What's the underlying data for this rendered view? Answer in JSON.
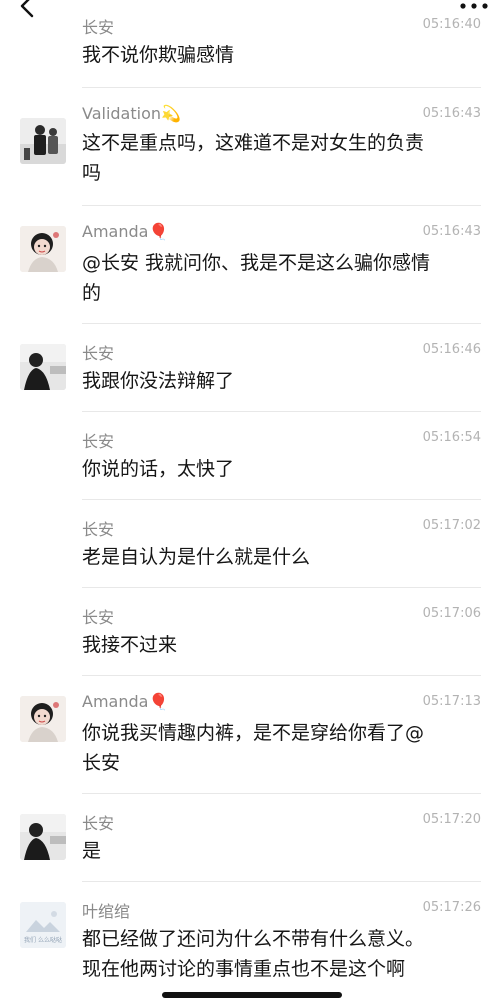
{
  "nav": {
    "back_icon": "chevron-left-icon",
    "more_icon": "ellipsis-icon"
  },
  "messages": [
    {
      "name": "长安",
      "time": "05:16:40",
      "text": "我不说你欺骗感情",
      "avatar": "none"
    },
    {
      "name": "Validation💫",
      "time": "05:16:43",
      "text": "这不是重点吗，这难道不是对女生的负责\n吗",
      "avatar": "validation"
    },
    {
      "name": "Amanda🎈",
      "time": "05:16:43",
      "text": "@长安 我就问你、我是不是这么骗你感情\n的",
      "avatar": "amanda"
    },
    {
      "name": "长安",
      "time": "05:16:46",
      "text": "我跟你没法辩解了",
      "avatar": "changan"
    },
    {
      "name": "长安",
      "time": "05:16:54",
      "text": "你说的话，太快了",
      "avatar": "none"
    },
    {
      "name": "长安",
      "time": "05:17:02",
      "text": "老是自认为是什么就是什么",
      "avatar": "none"
    },
    {
      "name": "长安",
      "time": "05:17:06",
      "text": "我接不过来",
      "avatar": "none"
    },
    {
      "name": "Amanda🎈",
      "time": "05:17:13",
      "text": "你说我买情趣内裤，是不是穿给你看了@\n长安",
      "avatar": "amanda"
    },
    {
      "name": "长安",
      "time": "05:17:20",
      "text": "是",
      "avatar": "changan"
    },
    {
      "name": "叶绾绾",
      "time": "05:17:26",
      "text": "都已经做了还问为什么不带有什么意义。\n现在他两讨论的事情重点也不是这个啊",
      "avatar": "yewanwan"
    }
  ],
  "avatar_tiny_text": "我们 么么哒哒"
}
